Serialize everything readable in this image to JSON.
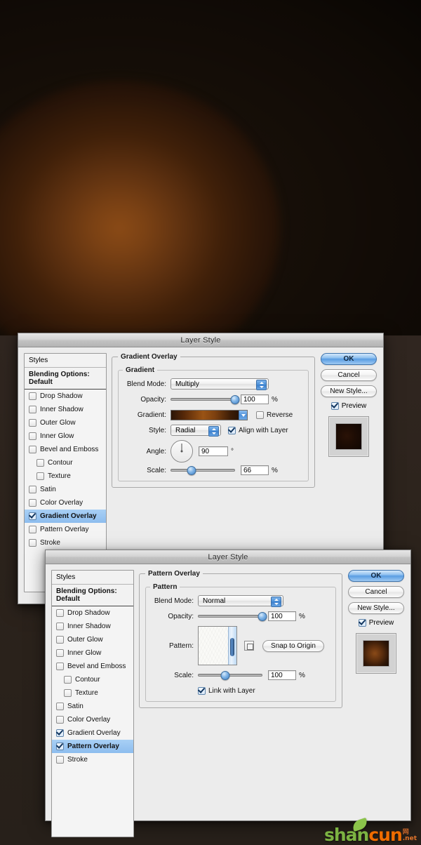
{
  "app": {
    "dialog_title": "Layer Style",
    "canvas_description": "dark brown canvas with radial orange glow"
  },
  "styles_panel": {
    "header": "Styles",
    "blending_options": "Blending Options: Default",
    "effects": [
      {
        "label": "Drop Shadow",
        "checked": false,
        "indent": false
      },
      {
        "label": "Inner Shadow",
        "checked": false,
        "indent": false
      },
      {
        "label": "Outer Glow",
        "checked": false,
        "indent": false
      },
      {
        "label": "Inner Glow",
        "checked": false,
        "indent": false
      },
      {
        "label": "Bevel and Emboss",
        "checked": false,
        "indent": false
      },
      {
        "label": "Contour",
        "checked": false,
        "indent": true
      },
      {
        "label": "Texture",
        "checked": false,
        "indent": true
      },
      {
        "label": "Satin",
        "checked": false,
        "indent": false
      },
      {
        "label": "Color Overlay",
        "checked": false,
        "indent": false
      },
      {
        "label": "Gradient Overlay",
        "checked": true,
        "indent": false
      },
      {
        "label": "Pattern Overlay",
        "checked": false,
        "indent": false
      },
      {
        "label": "Stroke",
        "checked": false,
        "indent": false
      }
    ]
  },
  "styles_panel_2": {
    "header": "Styles",
    "blending_options": "Blending Options: Default",
    "effects": [
      {
        "label": "Drop Shadow",
        "checked": false,
        "indent": false
      },
      {
        "label": "Inner Shadow",
        "checked": false,
        "indent": false
      },
      {
        "label": "Outer Glow",
        "checked": false,
        "indent": false
      },
      {
        "label": "Inner Glow",
        "checked": false,
        "indent": false
      },
      {
        "label": "Bevel and Emboss",
        "checked": false,
        "indent": false
      },
      {
        "label": "Contour",
        "checked": false,
        "indent": true
      },
      {
        "label": "Texture",
        "checked": false,
        "indent": true
      },
      {
        "label": "Satin",
        "checked": false,
        "indent": false
      },
      {
        "label": "Color Overlay",
        "checked": false,
        "indent": false
      },
      {
        "label": "Gradient Overlay",
        "checked": true,
        "indent": false
      },
      {
        "label": "Pattern Overlay",
        "checked": true,
        "indent": false
      },
      {
        "label": "Stroke",
        "checked": false,
        "indent": false
      }
    ]
  },
  "gradient_dialog": {
    "title": "Layer Style",
    "group_title": "Gradient Overlay",
    "subgroup_title": "Gradient",
    "blend_mode_label": "Blend Mode:",
    "blend_mode_value": "Multiply",
    "opacity_label": "Opacity:",
    "opacity_value": "100",
    "opacity_unit": "%",
    "gradient_label": "Gradient:",
    "reverse_label": "Reverse",
    "reverse_checked": false,
    "style_label": "Style:",
    "style_value": "Radial",
    "align_label": "Align with Layer",
    "align_checked": true,
    "angle_label": "Angle:",
    "angle_value": "90",
    "angle_unit": "°",
    "scale_label": "Scale:",
    "scale_value": "66",
    "scale_unit": "%",
    "gradient_colors": [
      "#2b1406",
      "#9a5314",
      "#150a03"
    ]
  },
  "pattern_dialog": {
    "title": "Layer Style",
    "group_title": "Pattern Overlay",
    "subgroup_title": "Pattern",
    "blend_mode_label": "Blend Mode:",
    "blend_mode_value": "Normal",
    "opacity_label": "Opacity:",
    "opacity_value": "100",
    "opacity_unit": "%",
    "pattern_label": "Pattern:",
    "snap_button": "Snap to Origin",
    "scale_label": "Scale:",
    "scale_value": "100",
    "scale_unit": "%",
    "link_label": "Link with Layer",
    "link_checked": true
  },
  "buttons": {
    "ok": "OK",
    "cancel": "Cancel",
    "new_style": "New Style...",
    "preview": "Preview",
    "preview_checked": true
  },
  "watermark": {
    "part1": "shan",
    "part2": "cun",
    "side_top": "网",
    "side_bottom": ".net",
    "color1": "#7cb342",
    "color2": "#ef6c00"
  }
}
